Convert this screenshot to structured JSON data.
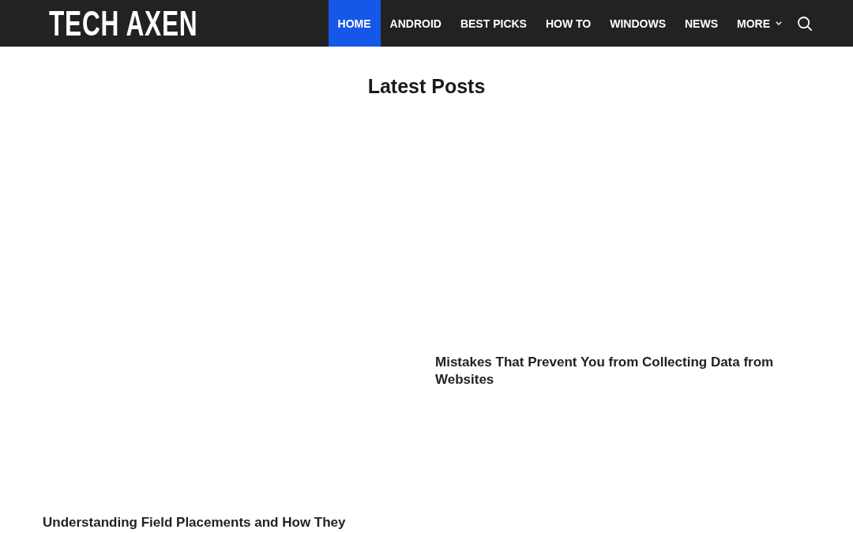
{
  "header": {
    "logo": "TECH AXEN",
    "nav": [
      {
        "label": "HOME",
        "kind": "link",
        "selected": true
      },
      {
        "label": "ANDROID",
        "kind": "link",
        "selected": false
      },
      {
        "label": "BEST PICKS",
        "kind": "link",
        "selected": false
      },
      {
        "label": "HOW TO",
        "kind": "link",
        "selected": false
      },
      {
        "label": "WINDOWS",
        "kind": "link",
        "selected": false
      },
      {
        "label": "NEWS",
        "kind": "link",
        "selected": false
      },
      {
        "label": "MORE",
        "kind": "menu",
        "selected": false
      }
    ]
  },
  "heading": "Latest Posts",
  "posts": [
    {
      "title": "Mistakes That Prevent You from Collecting Data from Websites"
    },
    {
      "title": "Understanding Field Placements and How They"
    }
  ]
}
